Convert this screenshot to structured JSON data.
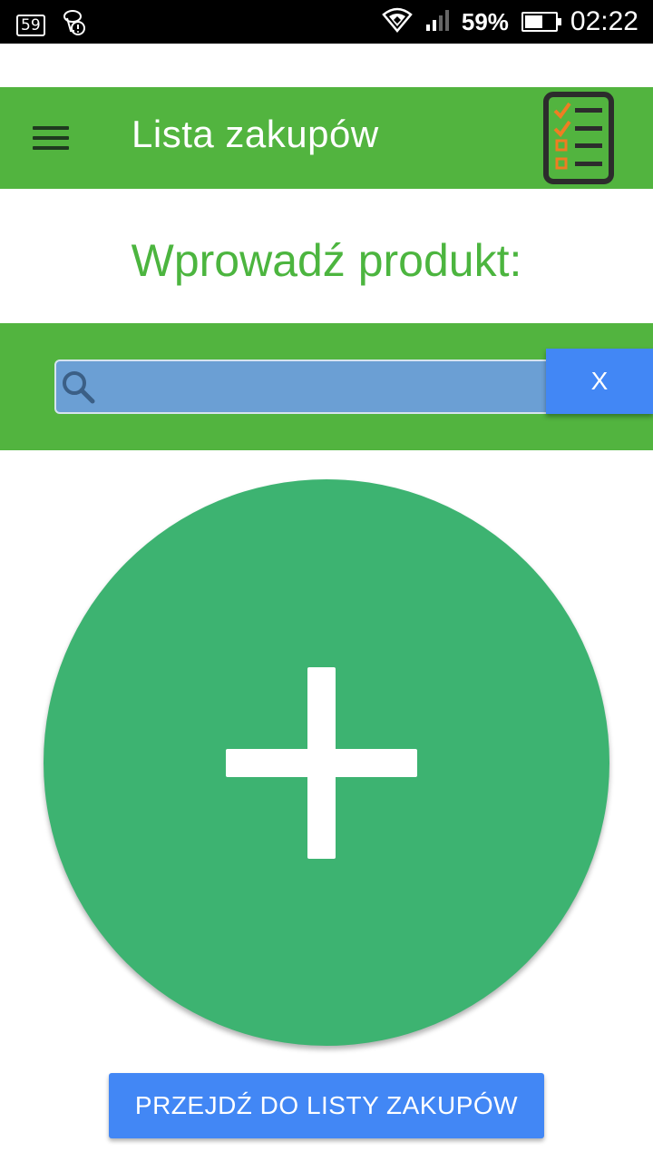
{
  "status_bar": {
    "notification_count": "59",
    "battery_percent": "59%",
    "battery_level": 0.59,
    "time": "02:22",
    "icons": [
      "notification-badge-icon",
      "sim-alert-icon",
      "wifi-icon",
      "signal-icon",
      "battery-icon"
    ]
  },
  "app_bar": {
    "title": "Lista zakupów",
    "menu_icon": "hamburger-menu-icon",
    "logo_icon": "checklist-icon",
    "color": "#52b43f"
  },
  "main": {
    "heading": "Wprowadź produkt:",
    "search": {
      "value": "",
      "placeholder": "",
      "icon": "search-icon"
    },
    "clear_button_label": "X",
    "add_icon": "plus-icon",
    "go_to_list_label": "PRZEJDŹ DO LISTY ZAKUPÓW"
  },
  "colors": {
    "green": "#52b43f",
    "circle_green": "#3db371",
    "blue": "#4287f5",
    "search_bg": "#6b9fd4"
  }
}
